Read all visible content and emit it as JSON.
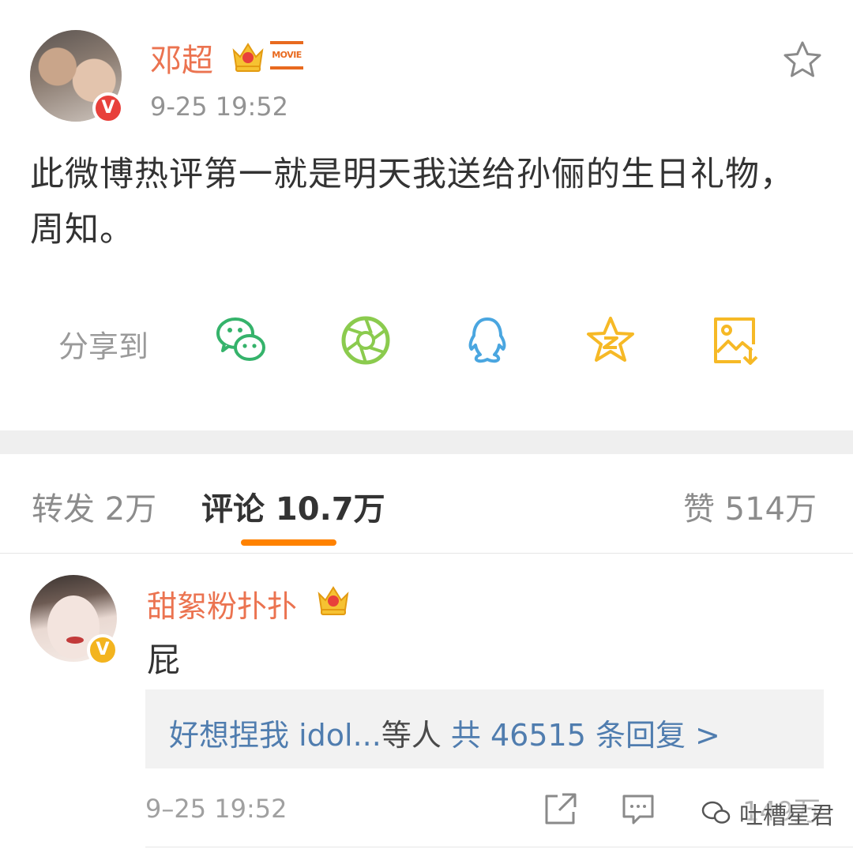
{
  "post": {
    "author": "邓超",
    "movie_badge": "MOVIE",
    "time": "9-25 19:52",
    "text": "此微博热评第一就是明天我送给孙俪的生日礼物，周知。",
    "verified_mark": "V"
  },
  "share": {
    "label": "分享到",
    "targets": [
      "wechat-icon",
      "moments-icon",
      "qq-icon",
      "qzone-icon",
      "save-image-icon"
    ]
  },
  "tabs": {
    "repost": "转发 2万",
    "comment": "评论 10.7万",
    "like": "赞 514万"
  },
  "comment": {
    "author": "甜絮粉扑扑",
    "text": "屁",
    "verified_mark": "V",
    "reply_users": "好想捏我 idol...",
    "reply_suffix": "等人",
    "reply_total": "共 46515 条回复 >",
    "time": "9–25 19:52",
    "likes": "149万"
  },
  "watermark": "吐槽星君",
  "colors": {
    "username": "#eb7350",
    "link": "#507daf",
    "accent": "#ff8200",
    "verified_red": "#e8403b",
    "verified_gold": "#f3b41f"
  }
}
